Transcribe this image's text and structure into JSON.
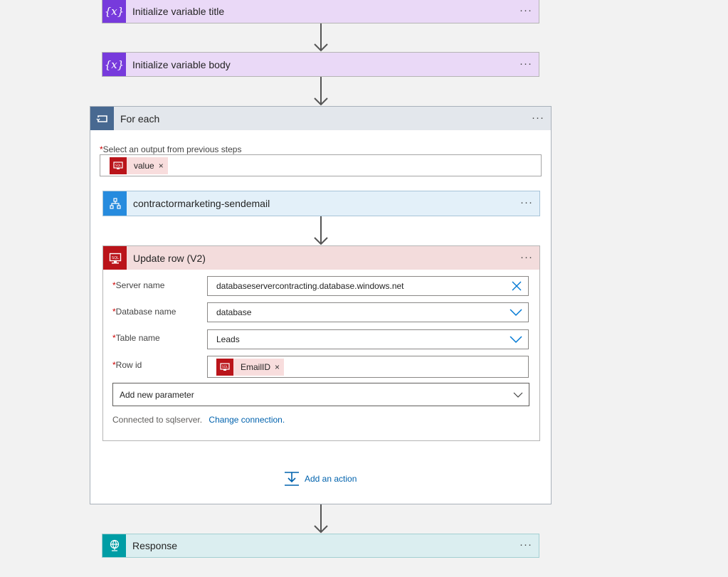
{
  "steps": {
    "init_title": {
      "title": "Initialize variable title",
      "icon": "variable-icon"
    },
    "init_body": {
      "title": "Initialize variable body",
      "icon": "variable-icon"
    },
    "for_each": {
      "title": "For each",
      "icon": "loop-icon",
      "select_label": "Select an output from previous steps",
      "token": "value"
    },
    "send_email": {
      "title": "contractormarketing-sendemail",
      "icon": "workflow-icon"
    },
    "update_row": {
      "title": "Update row (V2)",
      "icon": "sql-icon",
      "fields": {
        "server_label": "Server name",
        "server_value": "databaseservercontracting.database.windows.net",
        "database_label": "Database name",
        "database_value": "database",
        "table_label": "Table name",
        "table_value": "Leads",
        "rowid_label": "Row id",
        "rowid_token": "EmailID"
      },
      "add_param": "Add new parameter",
      "connected_text": "Connected to sqlserver.",
      "change_link": "Change connection."
    },
    "add_action": "Add an action",
    "response": {
      "title": "Response",
      "icon": "globe-icon"
    }
  },
  "more_label": "···",
  "required_mark": "*",
  "token_remove": "×",
  "colors": {
    "variable": "#773adc",
    "variable_bg": "#ead9f7",
    "loop": "#486991",
    "loop_bg": "#e3e7ec",
    "workflow": "#268bde",
    "workflow_bg": "#e3f0f9",
    "sql": "#ba141a",
    "sql_bg": "#f3dcdc",
    "response": "#009da5",
    "response_bg": "#dbeef0",
    "link": "#0062ad"
  }
}
